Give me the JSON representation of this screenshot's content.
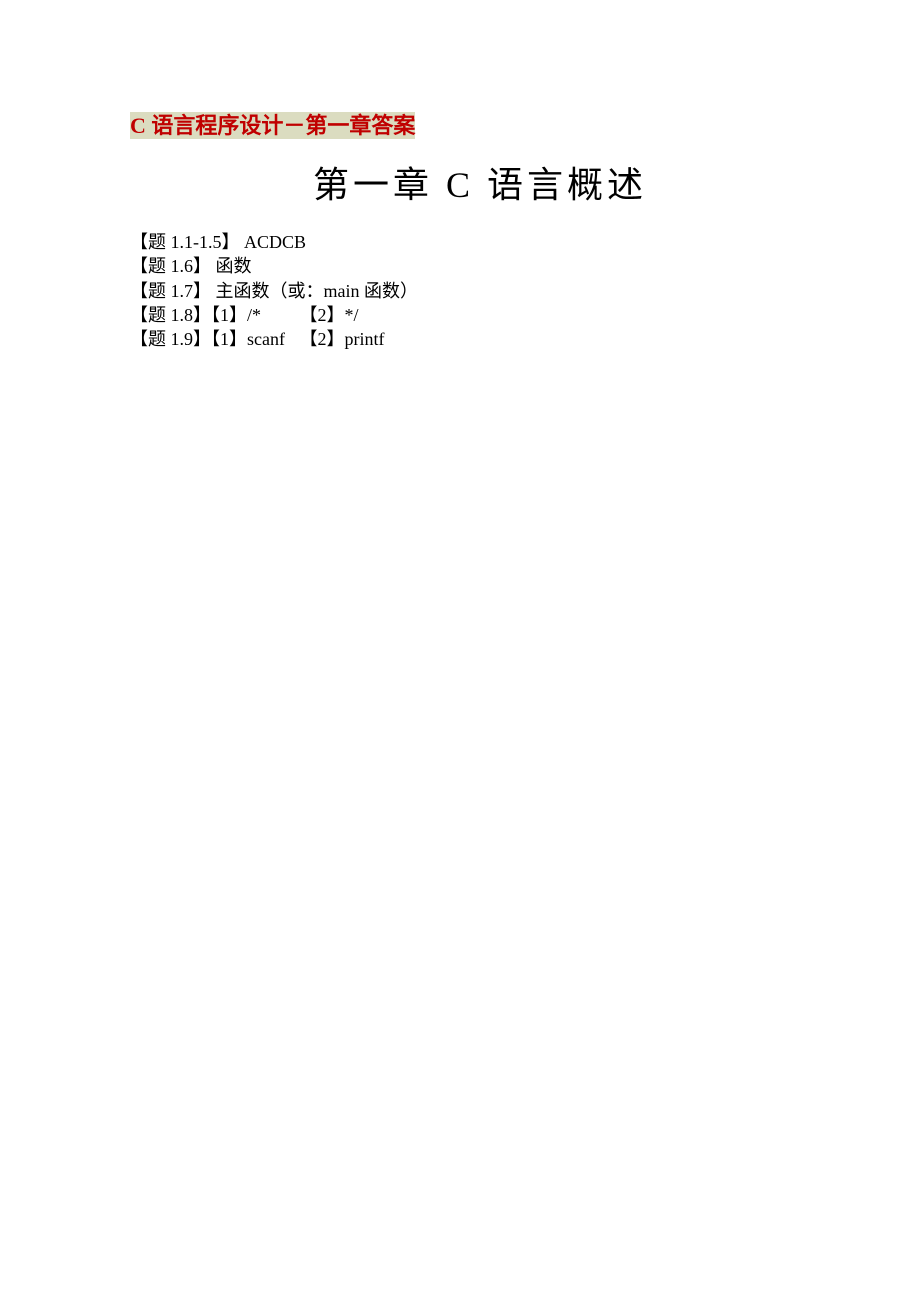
{
  "header": {
    "title_prefix": "C",
    "title_rest": " 语言程序设计－第一章答案"
  },
  "chapter": {
    "heading": "第一章   C 语言概述"
  },
  "answers": {
    "line1": "【题 1.1-1.5】 ACDCB",
    "line2": "【题 1.6】 函数",
    "line3": "【题 1.7】 主函数（或：main 函数）",
    "line4_a": "【题 1.8】【1】/*",
    "line4_b": "【2】*/",
    "line5_a": "【题 1.9】【1】scanf",
    "line5_b": "【2】printf"
  }
}
